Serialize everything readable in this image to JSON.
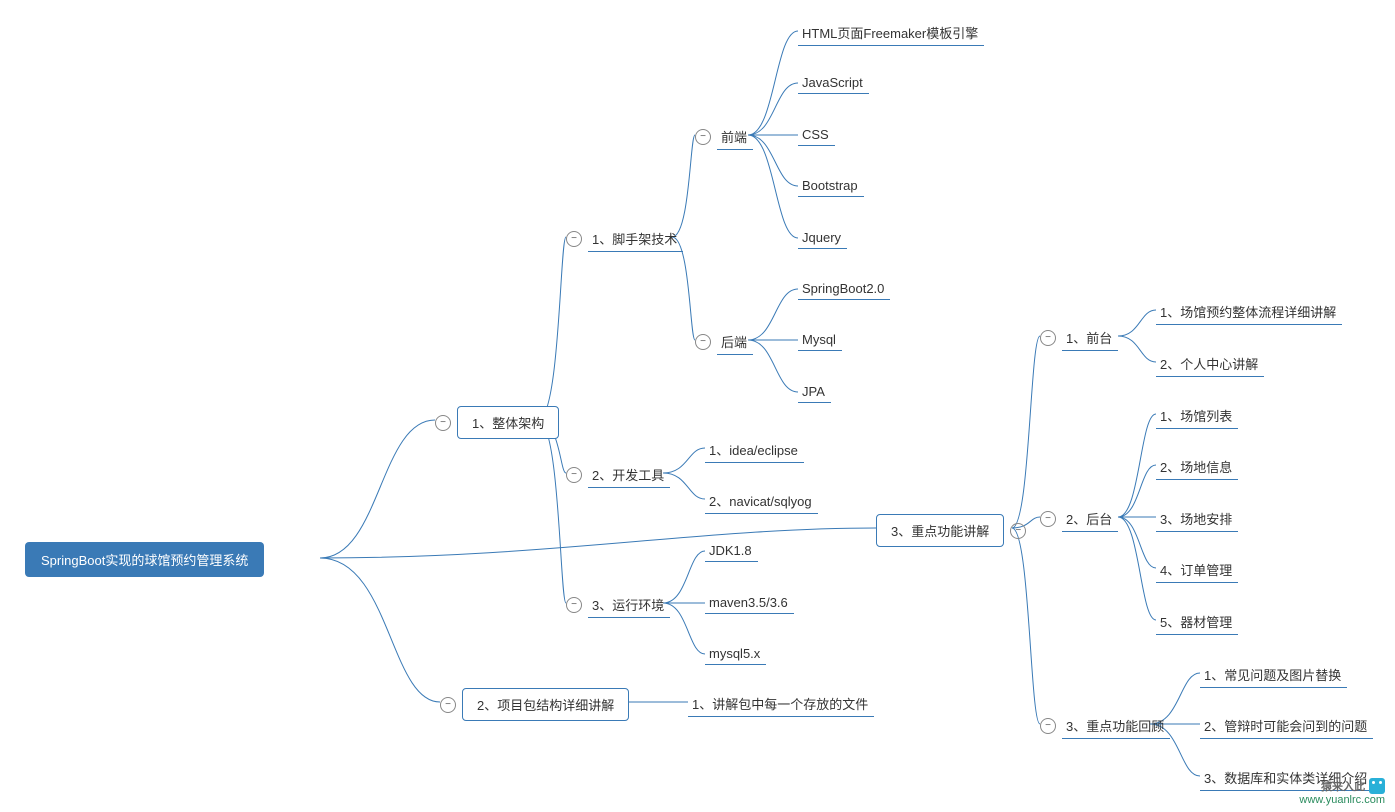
{
  "root": {
    "label": "SpringBoot实现的球馆预约管理系统"
  },
  "n1": {
    "label": "1、整体架构"
  },
  "n2": {
    "label": "2、项目包结构详细讲解"
  },
  "n3": {
    "label": "3、重点功能讲解"
  },
  "n1_1": {
    "label": "1、脚手架技术"
  },
  "n1_2": {
    "label": "2、开发工具"
  },
  "n1_3": {
    "label": "3、运行环境"
  },
  "n1_1_fe": {
    "label": "前端"
  },
  "n1_1_be": {
    "label": "后端"
  },
  "fe_html": {
    "label": "HTML页面Freemaker模板引擎"
  },
  "fe_js": {
    "label": "JavaScript"
  },
  "fe_css": {
    "label": "CSS"
  },
  "fe_bootstrap": {
    "label": "Bootstrap"
  },
  "fe_jquery": {
    "label": "Jquery"
  },
  "be_sb": {
    "label": "SpringBoot2.0"
  },
  "be_mysql": {
    "label": "Mysql"
  },
  "be_jpa": {
    "label": "JPA"
  },
  "tool_idea": {
    "label": "1、idea/eclipse"
  },
  "tool_navicat": {
    "label": "2、navicat/sqlyog"
  },
  "env_jdk": {
    "label": "JDK1.8"
  },
  "env_maven": {
    "label": "maven3.5/3.6"
  },
  "env_mysql": {
    "label": "mysql5.x"
  },
  "n2_1": {
    "label": "1、讲解包中每一个存放的文件"
  },
  "n3_1": {
    "label": "1、前台"
  },
  "n3_2": {
    "label": "2、后台"
  },
  "n3_3": {
    "label": "3、重点功能回顾"
  },
  "fd_1": {
    "label": "1、场馆预约整体流程详细讲解"
  },
  "fd_2": {
    "label": "2、个人中心讲解"
  },
  "bd_1": {
    "label": "1、场馆列表"
  },
  "bd_2": {
    "label": "2、场地信息"
  },
  "bd_3": {
    "label": "3、场地安排"
  },
  "bd_4": {
    "label": "4、订单管理"
  },
  "bd_5": {
    "label": "5、器材管理"
  },
  "rv_1": {
    "label": "1、常见问题及图片替换"
  },
  "rv_2": {
    "label": "2、管辩时可能会问到的问题"
  },
  "rv_3": {
    "label": "3、数据库和实体类详细介绍"
  },
  "watermark": {
    "title": "猿来入此",
    "url": "www.yuanlrc.com"
  },
  "colors": {
    "primary": "#3a7ab6"
  }
}
